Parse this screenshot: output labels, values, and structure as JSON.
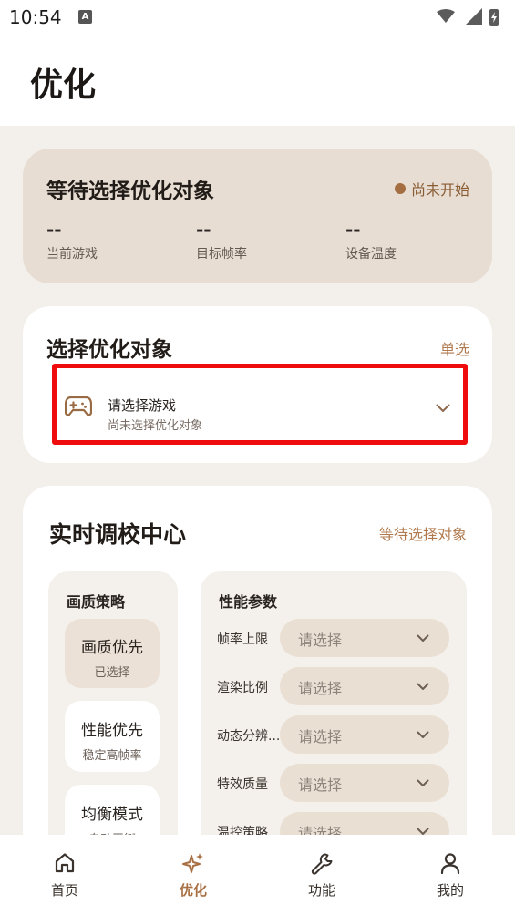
{
  "status_bar": {
    "time": "10:54",
    "badge": "A"
  },
  "page": {
    "title": "优化"
  },
  "status_card": {
    "title": "等待选择优化对象",
    "badge": "尚未开始",
    "metrics": [
      {
        "value": "--",
        "label": "当前游戏"
      },
      {
        "value": "--",
        "label": "目标帧率"
      },
      {
        "value": "--",
        "label": "设备温度"
      }
    ]
  },
  "select_card": {
    "title": "选择优化对象",
    "mode": "单选",
    "picker": {
      "title": "请选择游戏",
      "subtitle": "尚未选择优化对象"
    }
  },
  "tune_card": {
    "title": "实时调校中心",
    "status": "等待选择对象",
    "strategy": {
      "title": "画质策略",
      "options": [
        {
          "label": "画质优先",
          "sub": "已选择"
        },
        {
          "label": "性能优先",
          "sub": "稳定高帧率"
        },
        {
          "label": "均衡模式",
          "sub": "自动平衡"
        }
      ]
    },
    "params": {
      "title": "性能参数",
      "rows": [
        {
          "label": "帧率上限",
          "value": "请选择"
        },
        {
          "label": "渲染比例",
          "value": "请选择"
        },
        {
          "label": "动态分辨...",
          "value": "请选择"
        },
        {
          "label": "特效质量",
          "value": "请选择"
        },
        {
          "label": "温控策略",
          "value": "请选择"
        }
      ]
    }
  },
  "bottom_nav": [
    {
      "label": "首页",
      "icon": "home-icon"
    },
    {
      "label": "优化",
      "icon": "sparkle-icon",
      "active": true
    },
    {
      "label": "功能",
      "icon": "wrench-icon"
    },
    {
      "label": "我的",
      "icon": "person-icon"
    }
  ],
  "colors": {
    "accent": "#a86f42",
    "highlight": "#ee0c0c",
    "status_card_bg": "#e7ddd3"
  }
}
